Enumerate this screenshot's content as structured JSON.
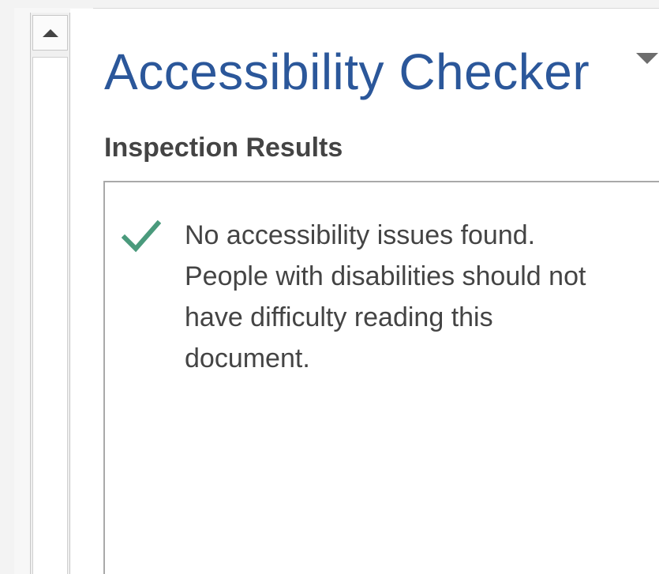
{
  "pane": {
    "title": "Accessibility Checker",
    "menu_icon": "chevron-down-icon"
  },
  "scrollbar": {
    "up_icon": "scroll-up-arrow-icon"
  },
  "results": {
    "heading": "Inspection Results",
    "status_icon": "checkmark-icon",
    "status_color": "#4a9a7c",
    "message": "No accessibility issues found.\nPeople with disabilities should not\nhave difficulty reading this\ndocument."
  },
  "colors": {
    "title": "#2b579a",
    "text": "#444444",
    "border": "#a9a9a9"
  }
}
